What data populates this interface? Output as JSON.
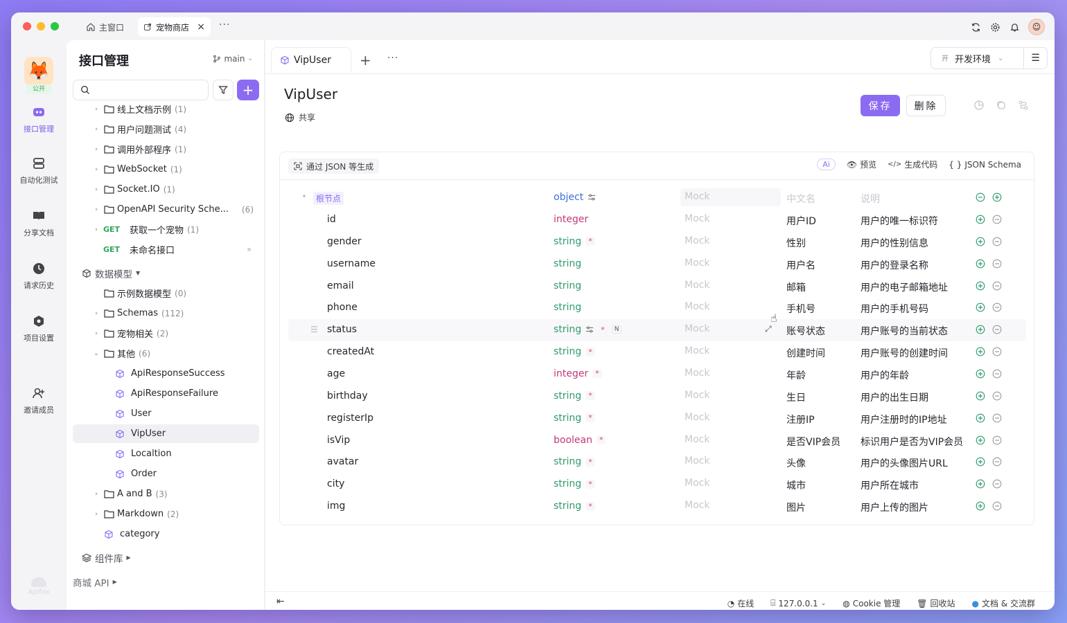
{
  "titlebar": {
    "tab_home": "主窗口",
    "tab_shop": "宠物商店"
  },
  "rail": {
    "public_badge": "公开",
    "items": [
      {
        "label": "接口管理",
        "icon": "api-icon"
      },
      {
        "label": "自动化测试",
        "icon": "automation-icon"
      },
      {
        "label": "分享文档",
        "icon": "book-icon"
      },
      {
        "label": "请求历史",
        "icon": "history-icon"
      },
      {
        "label": "项目设置",
        "icon": "settings-icon"
      },
      {
        "label": "邀请成员",
        "icon": "invite-icon"
      }
    ],
    "brand": "Apifox"
  },
  "sidebar": {
    "title": "接口管理",
    "branch": "main",
    "search_placeholder": "",
    "tree": [
      {
        "type": "folder",
        "label": "线上文档示例",
        "count": "(1)",
        "level": 1,
        "chev": "›"
      },
      {
        "type": "folder",
        "label": "用户问题测试",
        "count": "(4)",
        "level": 1,
        "chev": "›"
      },
      {
        "type": "folder",
        "label": "调用外部程序",
        "count": "(1)",
        "level": 1,
        "chev": "›"
      },
      {
        "type": "folder",
        "label": "WebSocket",
        "count": "(1)",
        "level": 1,
        "chev": "›"
      },
      {
        "type": "folder",
        "label": "Socket.IO",
        "count": "(1)",
        "level": 1,
        "chev": "›"
      },
      {
        "type": "folder",
        "label": "OpenAPI Security Sche...",
        "count": "(6)",
        "level": 1,
        "chev": "›",
        "count_right": true
      },
      {
        "type": "get",
        "label": "获取一个宠物",
        "count": "(1)",
        "level": 1,
        "chev": "›"
      },
      {
        "type": "get",
        "label": "未命名接口",
        "count": "",
        "level": 1,
        "chev": "",
        "dot": true
      },
      {
        "type": "header",
        "label": "数据模型",
        "level": 0
      },
      {
        "type": "folder",
        "label": "示例数据模型",
        "count": "(0)",
        "level": 1,
        "chev": ""
      },
      {
        "type": "folder",
        "label": "Schemas",
        "count": "(112)",
        "level": 1,
        "chev": "›"
      },
      {
        "type": "folder",
        "label": "宠物相关",
        "count": "(2)",
        "level": 1,
        "chev": "›"
      },
      {
        "type": "folder",
        "label": "其他",
        "count": "(6)",
        "level": 1,
        "chev": "⌄"
      },
      {
        "type": "model",
        "label": "ApiResponseSuccess",
        "level": 2
      },
      {
        "type": "model",
        "label": "ApiResponseFailure",
        "level": 2
      },
      {
        "type": "model",
        "label": "User",
        "level": 2
      },
      {
        "type": "model",
        "label": "VipUser",
        "level": 2,
        "selected": true
      },
      {
        "type": "model",
        "label": "Localtion",
        "level": 2
      },
      {
        "type": "model",
        "label": "Order",
        "level": 2
      },
      {
        "type": "folder",
        "label": "A and B",
        "count": "(3)",
        "level": 1,
        "chev": "›"
      },
      {
        "type": "folder",
        "label": "Markdown",
        "count": "(2)",
        "level": 1,
        "chev": "›"
      },
      {
        "type": "model",
        "label": "category",
        "level": 1.5
      },
      {
        "type": "header",
        "label": "组件库",
        "level": 0
      },
      {
        "type": "plain",
        "label": "商城 API",
        "level": -1
      }
    ],
    "get_label": "GET"
  },
  "main": {
    "tab": "VipUser",
    "env": "开发环境",
    "env_badge": "开",
    "title": "VipUser",
    "share": "共享",
    "save": "保存",
    "delete": "删除",
    "gen_json": "通过 JSON 等生成",
    "ai": "Ai",
    "preview": "预览",
    "gen_code": "生成代码",
    "json_schema": "JSON Schema",
    "root": {
      "label": "根节点",
      "type": "object",
      "mock": "Mock",
      "cn": "中文名",
      "desc": "说明"
    },
    "fields": [
      {
        "name": "id",
        "type": "integer",
        "req": false,
        "cn": "用户ID",
        "desc": "用户的唯一标识符"
      },
      {
        "name": "gender",
        "type": "string",
        "req": true,
        "cn": "性别",
        "desc": "用户的性别信息"
      },
      {
        "name": "username",
        "type": "string",
        "req": false,
        "cn": "用户名",
        "desc": "用户的登录名称"
      },
      {
        "name": "email",
        "type": "string",
        "req": false,
        "cn": "邮箱",
        "desc": "用户的电子邮箱地址"
      },
      {
        "name": "phone",
        "type": "string",
        "req": false,
        "cn": "手机号",
        "desc": "用户的手机号码"
      },
      {
        "name": "status",
        "type": "string",
        "req": true,
        "tags": true,
        "cn": "账号状态",
        "desc": "用户账号的当前状态",
        "hover": true
      },
      {
        "name": "createdAt",
        "type": "string",
        "req": true,
        "cn": "创建时间",
        "desc": "用户账号的创建时间"
      },
      {
        "name": "age",
        "type": "integer",
        "req": true,
        "cn": "年龄",
        "desc": "用户的年龄"
      },
      {
        "name": "birthday",
        "type": "string",
        "req": true,
        "cn": "生日",
        "desc": "用户的出生日期"
      },
      {
        "name": "registerIp",
        "type": "string",
        "req": true,
        "cn": "注册IP",
        "desc": "用户注册时的IP地址"
      },
      {
        "name": "isVip",
        "type": "boolean",
        "req": true,
        "cn": "是否VIP会员",
        "desc": "标识用户是否为VIP会员"
      },
      {
        "name": "avatar",
        "type": "string",
        "req": true,
        "cn": "头像",
        "desc": "用户的头像图片URL"
      },
      {
        "name": "city",
        "type": "string",
        "req": true,
        "cn": "城市",
        "desc": "用户所在城市"
      },
      {
        "name": "img",
        "type": "string",
        "req": true,
        "cn": "图片",
        "desc": "用户上传的图片"
      }
    ],
    "mock_placeholder": "Mock",
    "req_mark": "*",
    "nullable_tag": "N"
  },
  "footer": {
    "online": "在线",
    "host": "127.0.0.1",
    "cookie": "Cookie 管理",
    "recycle": "回收站",
    "docs": "文档 & 交流群"
  },
  "colors": {
    "accent": "#8b6cf0",
    "string_type": "#2f9a6b",
    "integer_type": "#c0397a",
    "object_type": "#3b6fd6",
    "get_method": "#2fa65b"
  }
}
